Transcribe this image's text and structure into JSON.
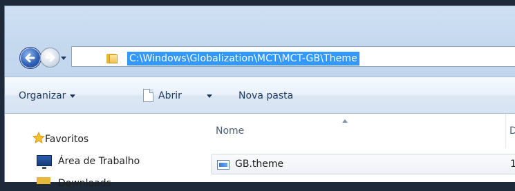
{
  "address_bar": {
    "path": "C:\\Windows\\Globalization\\MCT\\MCT-GB\\Theme"
  },
  "toolbar": {
    "organize_label": "Organizar",
    "open_label": "Abrir",
    "new_folder_label": "Nova pasta"
  },
  "navigation_pane": {
    "favorites_label": "Favoritos",
    "items": [
      {
        "label": "Área de Trabalho",
        "icon": "desktop-icon"
      },
      {
        "label": "Downloads",
        "icon": "downloads-folder-icon"
      }
    ]
  },
  "file_list": {
    "columns": [
      {
        "label": "Nome"
      },
      {
        "label": "D"
      }
    ],
    "rows": [
      {
        "name": "GB.theme",
        "date_partial": "1",
        "icon": "theme-file-icon"
      }
    ]
  },
  "colors": {
    "selection": "#3399ff",
    "toolbar_text": "#1e395b",
    "frame": "#c4d8ee"
  }
}
